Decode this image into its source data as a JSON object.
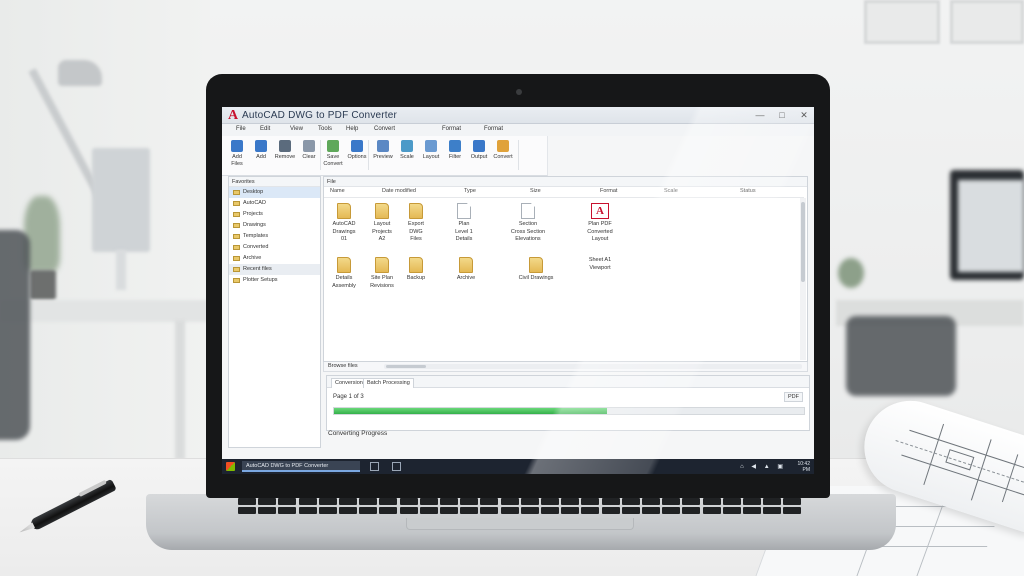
{
  "app": {
    "logo": "A",
    "title": "AutoCAD DWG to PDF Converter",
    "window_controls": [
      "—",
      "□",
      "✕"
    ]
  },
  "menu": [
    "File",
    "Edit",
    "View",
    "Tools",
    "Help",
    "Convert",
    "Format"
  ],
  "ribbon": {
    "buttons": [
      {
        "label": "Add",
        "label2": "Files",
        "icon": "add-files-icon",
        "color": "#3a78c9"
      },
      {
        "label": "Add",
        "label2": "",
        "icon": "add-folder-icon",
        "color": "#3a78c9"
      },
      {
        "label": "Remove",
        "label2": "",
        "icon": "remove-icon",
        "color": "#5b6b7d"
      },
      {
        "label": "Clear",
        "label2": "",
        "icon": "clear-icon",
        "color": "#8a97a8"
      },
      {
        "label": "Save",
        "label2": "Convert",
        "icon": "save-icon",
        "color": "#5fa85a"
      },
      {
        "label": "Options",
        "label2": "",
        "icon": "options-icon",
        "color": "#3a78c9"
      },
      {
        "label": "Preview",
        "label2": "",
        "icon": "preview-icon",
        "color": "#5b88c4"
      },
      {
        "label": "Scale",
        "label2": "",
        "icon": "scale-icon",
        "color": "#4c9ac8"
      },
      {
        "label": "Layout",
        "label2": "",
        "icon": "layout-icon",
        "color": "#6a9ad1"
      },
      {
        "label": "Filter",
        "label2": "",
        "icon": "filter-icon",
        "color": "#3d7fc9"
      },
      {
        "label": "Output",
        "label2": "",
        "icon": "output-icon",
        "color": "#3a78c9"
      },
      {
        "label": "Convert",
        "label2": "",
        "icon": "convert-icon",
        "color": "#e0a23a"
      }
    ]
  },
  "tree": {
    "header": "Favorites",
    "items": [
      {
        "label": "Desktop",
        "selected": true
      },
      {
        "label": "AutoCAD",
        "selected": false
      },
      {
        "label": "Projects",
        "selected": false
      },
      {
        "label": "Drawings",
        "selected": false
      },
      {
        "label": "Templates",
        "selected": false
      },
      {
        "label": "Converted",
        "selected": false
      },
      {
        "label": "Archive",
        "selected": false
      },
      {
        "label": "Recent files",
        "selected": false,
        "highlight": true
      },
      {
        "label": "Plotter Setups",
        "selected": false
      }
    ]
  },
  "files": {
    "path": "File",
    "columns": [
      "Name",
      "Date modified",
      "Type",
      "Size",
      "Format",
      "Scale",
      "Status"
    ],
    "items": [
      {
        "type": "folder",
        "l1": "AutoCAD",
        "l2": "Drawings",
        "l3": "01"
      },
      {
        "type": "folder",
        "l1": "Layout",
        "l2": "Projects",
        "l3": "A2"
      },
      {
        "type": "folder",
        "l1": "Export",
        "l2": "DWG",
        "l3": "Files"
      },
      {
        "type": "doc",
        "l1": "Plan",
        "l2": "Level 1",
        "l3": "Details"
      },
      {
        "type": "doc",
        "l1": "Section",
        "l2": "Cross Section",
        "l3": "Elevations"
      },
      {
        "type": "pdf",
        "l1": "Plan PDF",
        "l2": "Converted",
        "l3": "Layout"
      },
      {
        "type": "folder",
        "l1": "Details",
        "l2": "Assembly",
        "l3": ""
      },
      {
        "type": "folder",
        "l1": "Site Plan",
        "l2": "Revisions",
        "l3": ""
      },
      {
        "type": "folder",
        "l1": "Backup",
        "l2": "",
        "l3": ""
      },
      {
        "type": "folder",
        "l1": "Archive",
        "l2": "",
        "l3": ""
      },
      {
        "type": "folder",
        "l1": "Civil Drawings",
        "l2": "",
        "l3": ""
      },
      {
        "type": "pdf-text",
        "l1": "Sheet A1",
        "l2": "Viewport",
        "l3": ""
      }
    ],
    "status": "Browse files"
  },
  "conversion": {
    "tabs": [
      "Conversion",
      "Batch Processing"
    ],
    "label": "Page 1 of 3",
    "control": "PDF",
    "progress": 0.58,
    "progress_color": "#34b04a",
    "status": "Converting Progress"
  },
  "taskbar": {
    "app_label": "AutoCAD DWG to PDF Converter",
    "tray": "⌂ ◀ ▲ ▣",
    "time": "10:42",
    "date": "PM"
  }
}
